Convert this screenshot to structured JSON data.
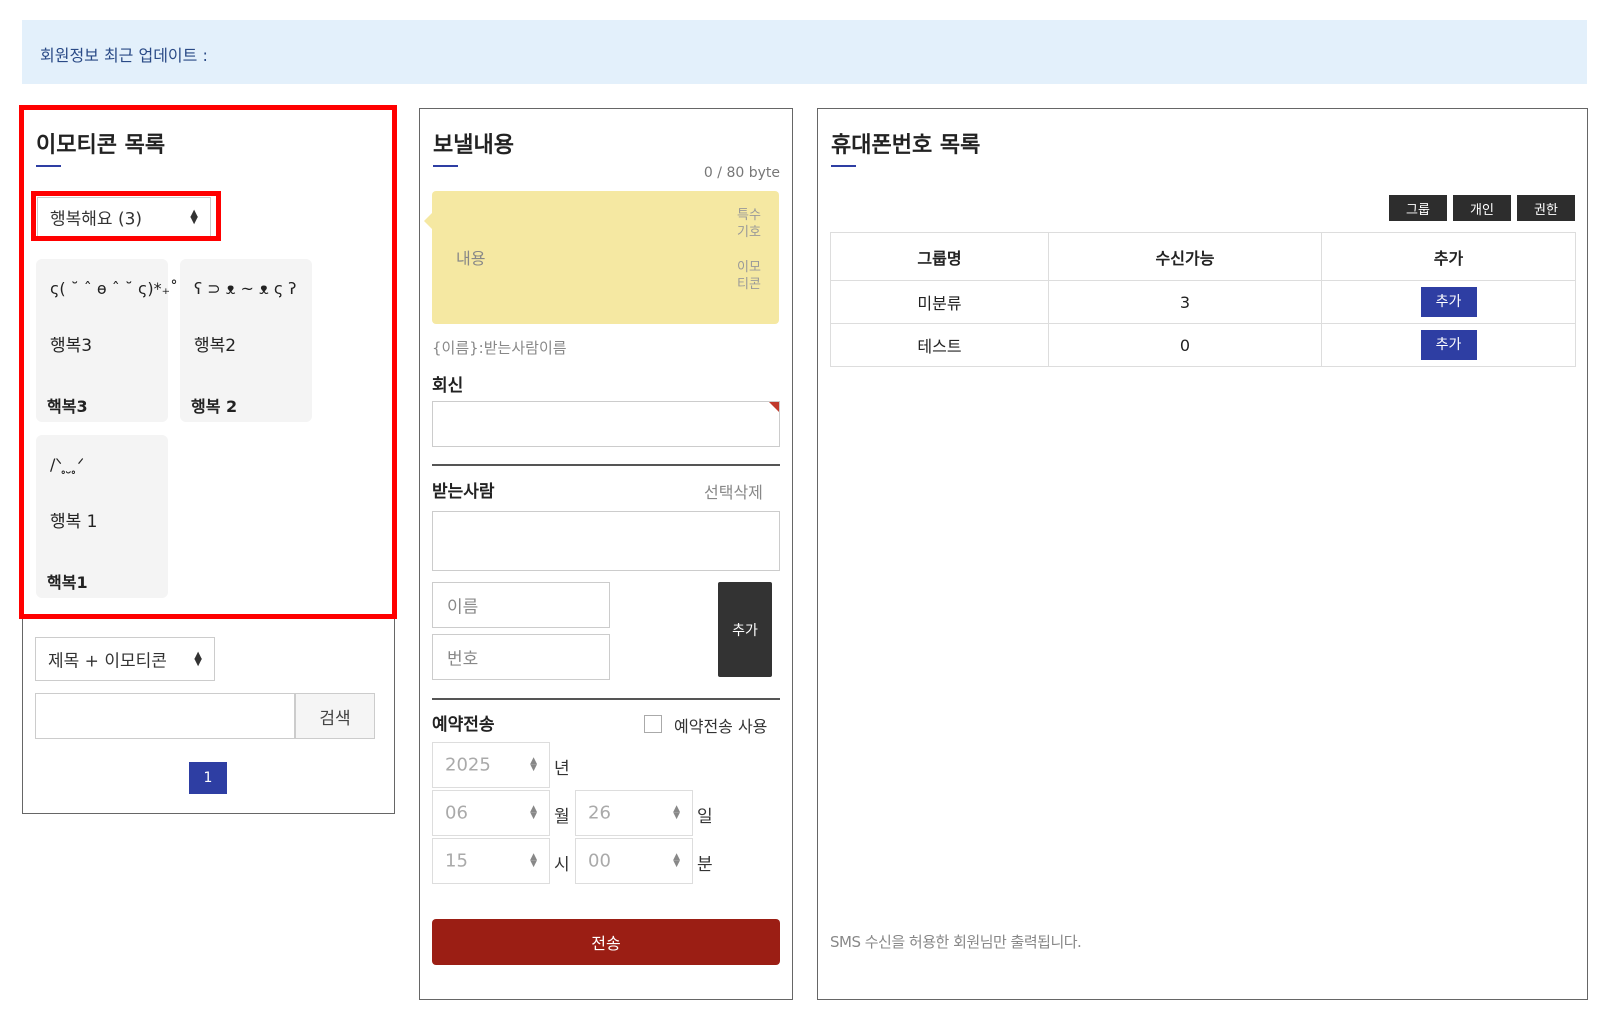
{
  "notice": {
    "text": "회원정보 최근 업데이트 :"
  },
  "emoticon_panel": {
    "title": "이모티콘 목록",
    "category_select": "행복해요 (3)",
    "cards": [
      {
        "face": "ς( ˘ ˆ ɵ ˆ ˘ ς)*₊˚",
        "name": "행복3",
        "title": "핵복3"
      },
      {
        "face": "ʕ ⊃ ᴥ ~ ᴥ ς ʔ",
        "name": "행복2",
        "title": "행복 2"
      },
      {
        "face": "/ᐠ ̥ ̮ ̥ᐟ",
        "name": "행복 1",
        "title": "핵복1"
      }
    ],
    "search_mode": "제목 + 이모티콘",
    "search_value": "",
    "search_button": "검색",
    "page": "1"
  },
  "send_panel": {
    "title": "보낼내용",
    "byte_count": "0 / 80 byte",
    "message_placeholder": "내용",
    "special_chars_link": "특수 기호",
    "emoticon_link": "이모 티콘",
    "name_hint": "{이름}:받는사람이름",
    "reply_label": "회신",
    "reply_value": "",
    "recipient_label": "받는사람",
    "delete_selected": "선택삭제",
    "name_placeholder": "이름",
    "number_placeholder": "번호",
    "add_button": "추가",
    "reserve_label": "예약전송",
    "reserve_checkbox_label": "예약전송 사용",
    "year": "2025",
    "year_unit": "년",
    "month": "06",
    "month_unit": "월",
    "day": "26",
    "day_unit": "일",
    "hour": "15",
    "hour_unit": "시",
    "minute": "00",
    "minute_unit": "분",
    "send_button": "전송"
  },
  "phone_panel": {
    "title": "휴대폰번호 목록",
    "tabs": [
      "그룹",
      "개인",
      "권한"
    ],
    "columns": [
      "그룹명",
      "수신가능",
      "추가"
    ],
    "rows": [
      {
        "group": "미분류",
        "count": "3",
        "action": "추가"
      },
      {
        "group": "테스트",
        "count": "0",
        "action": "추가"
      }
    ],
    "footnote": "SMS 수신을 허용한 회원님만 출력됩니다."
  }
}
